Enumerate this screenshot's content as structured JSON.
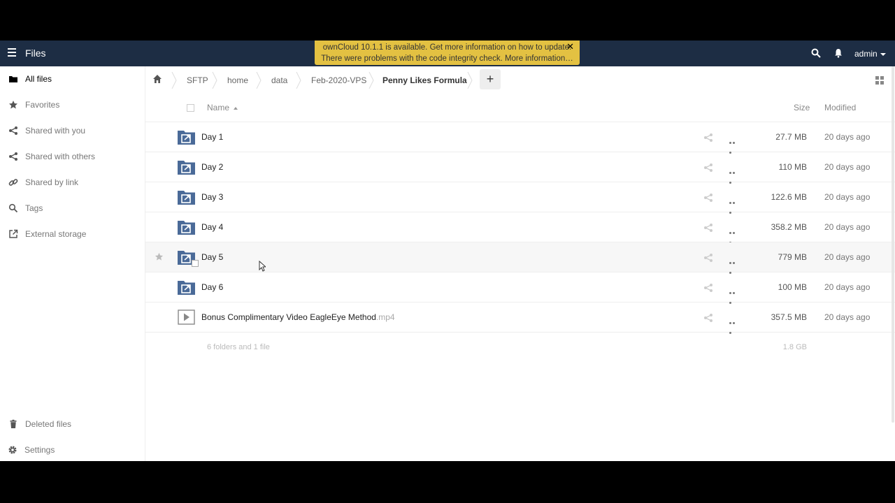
{
  "header": {
    "app_title": "Files",
    "notice_line1": "ownCloud 10.1.1 is available. Get more information on how to update.",
    "notice_line2": "There were problems with the code integrity check. More information…",
    "notice_close": "✕",
    "user": "admin",
    "bg_color": "#1d2d44",
    "notice_color": "#e3c142"
  },
  "sidebar": {
    "items": [
      {
        "label": "All files",
        "icon": "folder-icon"
      },
      {
        "label": "Favorites",
        "icon": "star-icon"
      },
      {
        "label": "Shared with you",
        "icon": "share-icon"
      },
      {
        "label": "Shared with others",
        "icon": "share-icon"
      },
      {
        "label": "Shared by link",
        "icon": "link-icon"
      },
      {
        "label": "Tags",
        "icon": "tag-icon"
      },
      {
        "label": "External storage",
        "icon": "external-icon"
      }
    ],
    "bottom": [
      {
        "label": "Deleted files",
        "icon": "trash-icon"
      },
      {
        "label": "Settings",
        "icon": "gear-icon"
      }
    ]
  },
  "breadcrumb": {
    "items": [
      "SFTP",
      "home",
      "data",
      "Feb-2020-VPS",
      "Penny Likes Formula"
    ],
    "add": "+"
  },
  "table": {
    "col_name": "Name",
    "col_size": "Size",
    "col_modified": "Modified",
    "rows": [
      {
        "name": "Day 1",
        "ext": "",
        "size": "27.7 MB",
        "modified": "20 days ago",
        "type": "external-folder"
      },
      {
        "name": "Day 2",
        "ext": "",
        "size": "110 MB",
        "modified": "20 days ago",
        "type": "external-folder"
      },
      {
        "name": "Day 3",
        "ext": "",
        "size": "122.6 MB",
        "modified": "20 days ago",
        "type": "external-folder"
      },
      {
        "name": "Day 4",
        "ext": "",
        "size": "358.2 MB",
        "modified": "20 days ago",
        "type": "external-folder"
      },
      {
        "name": "Day 5",
        "ext": "",
        "size": "779 MB",
        "modified": "20 days ago",
        "type": "external-folder"
      },
      {
        "name": "Day 6",
        "ext": "",
        "size": "100 MB",
        "modified": "20 days ago",
        "type": "external-folder"
      },
      {
        "name": "Bonus Complimentary Video EagleEye Method",
        "ext": ".mp4",
        "size": "357.5 MB",
        "modified": "20 days ago",
        "type": "video"
      }
    ],
    "summary_count": "6 folders and 1 file",
    "summary_total": "1.8 GB"
  }
}
